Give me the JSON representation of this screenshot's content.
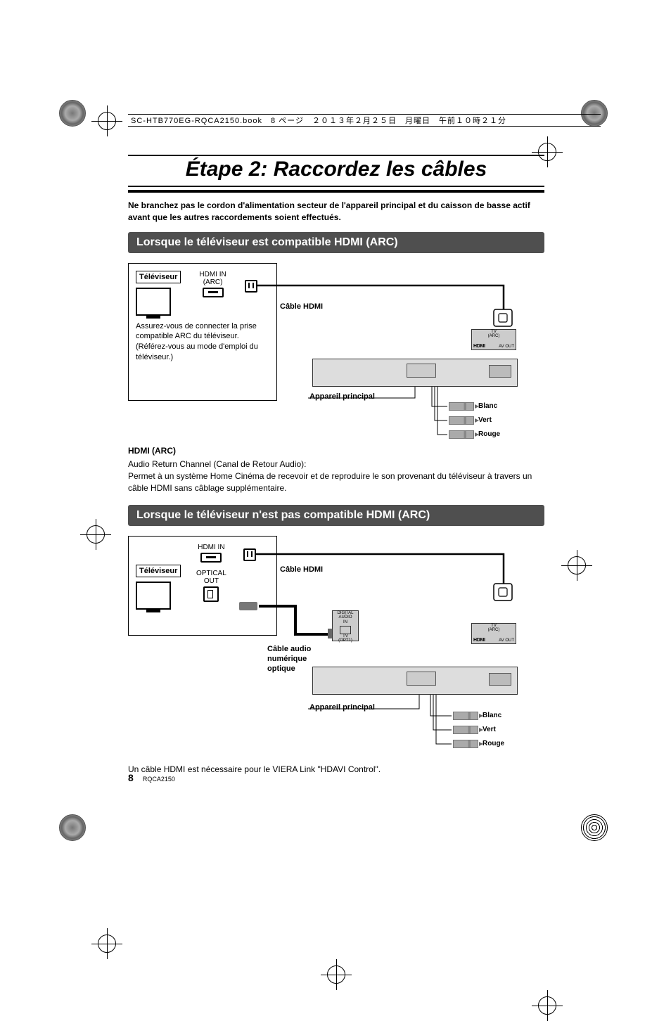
{
  "header": {
    "meta_line": "SC-HTB770EG-RQCA2150.book　8 ページ　２０１３年２月２５日　月曜日　午前１０時２１分"
  },
  "title": "Étape 2: Raccordez les câbles",
  "intro": "Ne branchez pas le cordon d'alimentation secteur de l'appareil principal et du caisson de basse actif avant que les autres raccordements soient effectués.",
  "section1": {
    "heading": "Lorsque le téléviseur est compatible HDMI (ARC)",
    "tv_label": "Téléviseur",
    "port_label_line1": "HDMI IN",
    "port_label_line2": "(ARC)",
    "note": "Assurez-vous de connecter la prise compatible ARC du téléviseur. (Référez-vous au mode d'emploi du téléviseur.)",
    "cable_hdmi": "Câble HDMI",
    "device_label": "Appareil principal",
    "back_tv": "TV",
    "back_arc": "(ARC)",
    "back_avout": "AV OUT",
    "back_hdmi_logo": "HDMI",
    "color_white": "Blanc",
    "color_green": "Vert",
    "color_red": "Rouge"
  },
  "hdmi_desc": {
    "heading": "HDMI (ARC)",
    "line1": "Audio Return Channel (Canal de Retour Audio):",
    "line2": "Permet à un système Home Cinéma de recevoir et de reproduire le son provenant du téléviseur à travers un câble HDMI sans câblage supplémentaire."
  },
  "section2": {
    "heading": "Lorsque le téléviseur n'est pas compatible HDMI (ARC)",
    "tv_label": "Téléviseur",
    "hdmi_in": "HDMI IN",
    "optical_out_1": "OPTICAL",
    "optical_out_2": "OUT",
    "cable_hdmi": "Câble HDMI",
    "cable_optical_1": "Câble audio",
    "cable_optical_2": "numérique",
    "cable_optical_3": "optique",
    "device_label": "Appareil principal",
    "back_digital_1": "DIGITAL",
    "back_digital_2": "AUDIO",
    "back_digital_3": "IN",
    "back_tv_opt_1": "TV",
    "back_tv_opt_2": "(OPT1)",
    "back_tv": "TV",
    "back_arc": "(ARC)",
    "back_avout": "AV OUT",
    "back_hdmi_logo": "HDMI",
    "color_white": "Blanc",
    "color_green": "Vert",
    "color_red": "Rouge",
    "footnote": "Un câble HDMI est nécessaire pour le VIERA Link \"HDAVI Control\"."
  },
  "footer": {
    "page": "8",
    "doc": "RQCA2150"
  }
}
